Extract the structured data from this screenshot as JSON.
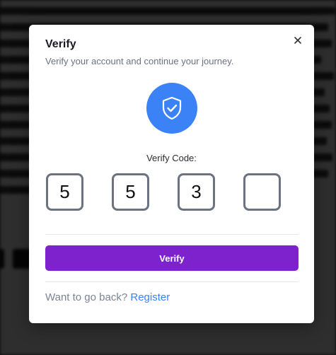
{
  "modal": {
    "title": "Verify",
    "subtitle": "Verify your account and continue your journey.",
    "close_icon": "close-icon",
    "shield_icon": "shield-check-icon",
    "code_label": "Verify Code:",
    "code_digits": [
      "5",
      "5",
      "3",
      ""
    ],
    "verify_button": "Verify",
    "footer_prompt": "Want to go back?",
    "footer_link": "Register"
  },
  "colors": {
    "accent_purple": "#7e22ce",
    "shield_blue": "#3b82f6",
    "link_blue": "#3b82f6",
    "code_border": "#6b7280"
  }
}
